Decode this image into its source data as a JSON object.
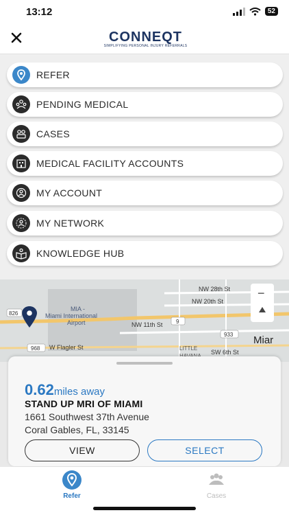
{
  "status": {
    "time": "13:12",
    "battery": "52"
  },
  "header": {
    "brand_name": "CONNEQT",
    "brand_tagline": "SIMPLIFYING PERSONAL INJURY REFERRALS"
  },
  "menu": {
    "items": [
      {
        "label": "REFER",
        "icon": "refer-pin-icon"
      },
      {
        "label": "PENDING MEDICAL",
        "icon": "group-icon"
      },
      {
        "label": "CASES",
        "icon": "people-icon"
      },
      {
        "label": "MEDICAL FACILITY ACCOUNTS",
        "icon": "building-icon"
      },
      {
        "label": "MY ACCOUNT",
        "icon": "user-icon"
      },
      {
        "label": "MY NETWORK",
        "icon": "network-icon"
      },
      {
        "label": "KNOWLEDGE HUB",
        "icon": "book-icon"
      }
    ]
  },
  "map": {
    "labels": {
      "nw28": "NW 28th St",
      "nw20": "NW 20th St",
      "nw11": "NW 11th St",
      "mia": "MIA -",
      "airport1": "Miami International",
      "airport2": "Airport",
      "flagler": "W Flagler St",
      "little": "LITTLE",
      "havana": "HAVANA",
      "sw6": "SW 6th St",
      "miami": "Miar",
      "r826": "826",
      "r9": "9",
      "r933": "933",
      "r968": "968"
    },
    "zoom_out": "−"
  },
  "card": {
    "distance_value": "0.62",
    "distance_unit": "miles away",
    "facility_name": "STAND UP MRI OF MIAMI",
    "address_line1": "1661 Southwest 37th Avenue",
    "address_line2": "Coral Gables, FL, 33145",
    "view_label": "VIEW",
    "select_label": "SELECT"
  },
  "tabs": [
    {
      "label": "Refer",
      "active": true
    },
    {
      "label": "Cases",
      "active": false
    }
  ],
  "colors": {
    "accent": "#2a78c2",
    "brand": "#1d3461",
    "pin": "#1d3461"
  }
}
